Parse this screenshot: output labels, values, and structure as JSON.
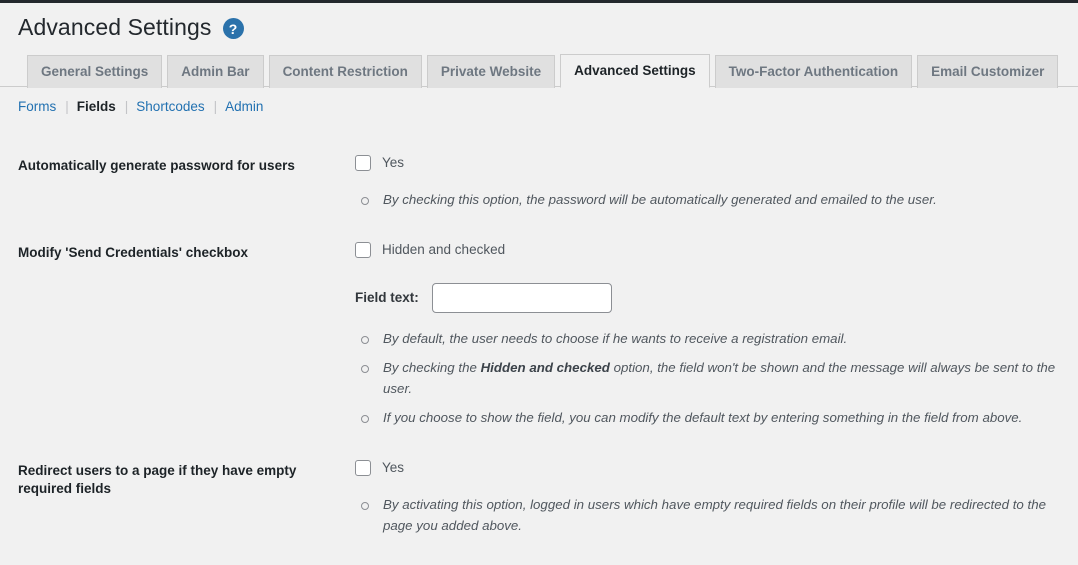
{
  "page": {
    "title": "Advanced Settings",
    "help_icon_glyph": "?",
    "help_icon_name": "help-circle-icon",
    "accent_color": "#2b72ab",
    "background_color": "#f1f1f1"
  },
  "tabs": [
    {
      "label": "General Settings",
      "active": false
    },
    {
      "label": "Admin Bar",
      "active": false
    },
    {
      "label": "Content Restriction",
      "active": false
    },
    {
      "label": "Private Website",
      "active": false
    },
    {
      "label": "Advanced Settings",
      "active": true
    },
    {
      "label": "Two-Factor Authentication",
      "active": false
    },
    {
      "label": "Email Customizer",
      "active": false
    }
  ],
  "subnav": [
    {
      "label": "Forms",
      "current": false
    },
    {
      "label": "Fields",
      "current": true
    },
    {
      "label": "Shortcodes",
      "current": false
    },
    {
      "label": "Admin",
      "current": false
    }
  ],
  "settings": [
    {
      "label": "Automatically generate password for users",
      "checkbox_label": "Yes",
      "checked": false,
      "descriptions": [
        "By checking this option, the password will be automatically generated and emailed to the user."
      ]
    },
    {
      "label": "Modify 'Send Credentials' checkbox",
      "checkbox_label": "Hidden and checked",
      "checked": false,
      "field_text_label": "Field text:",
      "field_text_value": "",
      "field_text_placeholder": "",
      "descriptions": [
        "By default, the user needs to choose if he wants to receive a registration email.",
        "By checking the Hidden and checked option, the field won't be shown and the message will always be sent to the user.",
        "If you choose to show the field, you can modify the default text by entering something in the field from above."
      ],
      "description_2_parts": {
        "before": "By checking the ",
        "bold": "Hidden and checked",
        "after": " option, the field won't be shown and the message will always be sent to the user."
      }
    },
    {
      "label": "Redirect users to a page if they have empty required fields",
      "checkbox_label": "Yes",
      "checked": false,
      "descriptions": [
        "By activating this option, logged in users which have empty required fields on their profile will be redirected to the page you added above."
      ]
    }
  ]
}
